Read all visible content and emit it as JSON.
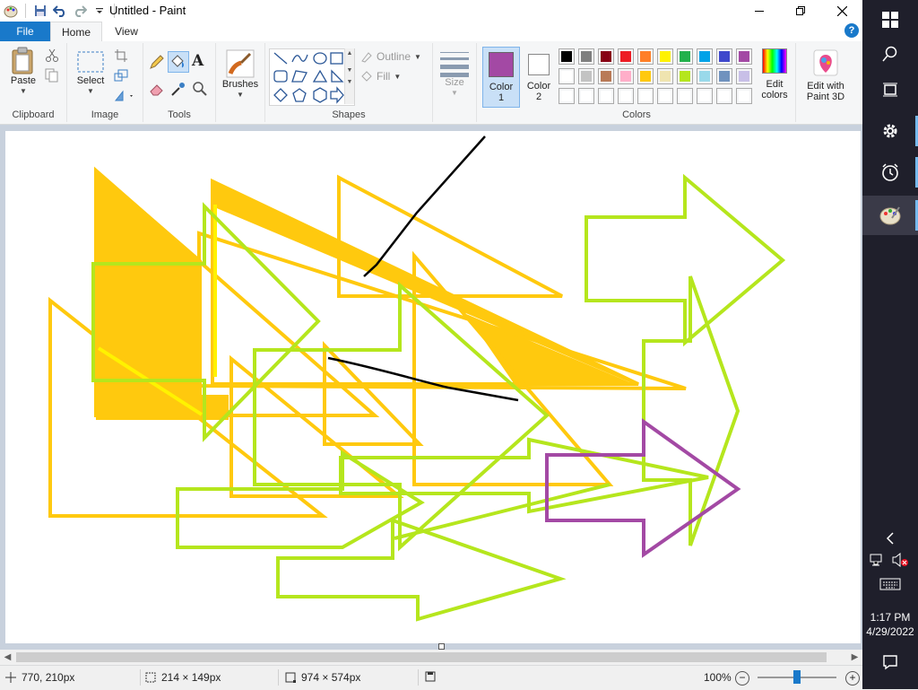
{
  "window": {
    "title": "Untitled - Paint"
  },
  "tabs": {
    "file": "File",
    "home": "Home",
    "view": "View"
  },
  "ribbon": {
    "clipboard": {
      "paste": "Paste",
      "group": "Clipboard"
    },
    "image": {
      "select": "Select",
      "group": "Image"
    },
    "tools": {
      "group": "Tools"
    },
    "brushes": {
      "label": "Brushes"
    },
    "shapes": {
      "group": "Shapes",
      "outline": "Outline",
      "fill": "Fill"
    },
    "size": {
      "label": "Size"
    },
    "colors": {
      "group": "Colors",
      "color1": "Color\n1",
      "color1_line1": "Color",
      "color1_line2": "1",
      "color2_line1": "Color",
      "color2_line2": "2",
      "color1_value": "#a349a4",
      "color2_value": "#ffffff",
      "edit_line1": "Edit",
      "edit_line2": "colors",
      "palette_row1": [
        "#000000",
        "#7f7f7f",
        "#880015",
        "#ed1c24",
        "#ff7f27",
        "#fff200",
        "#22b14c",
        "#00a2e8",
        "#3f48cc",
        "#a349a4"
      ],
      "palette_row2": [
        "#ffffff",
        "#c3c3c3",
        "#b97a57",
        "#ffaec9",
        "#ffc90e",
        "#efe4b0",
        "#b5e61d",
        "#99d9ea",
        "#7092be",
        "#c8bfe7"
      ],
      "palette_row3": [
        "#ffffff",
        "#ffffff",
        "#ffffff",
        "#ffffff",
        "#ffffff",
        "#ffffff",
        "#ffffff",
        "#ffffff",
        "#ffffff",
        "#ffffff"
      ]
    },
    "paint3d": {
      "line1": "Edit with",
      "line2": "Paint 3D"
    }
  },
  "status": {
    "cursor": "770, 210px",
    "selection": "214 × 149px",
    "canvas_size": "974 × 574px",
    "zoom": "100%",
    "zoom_fraction": 0.5
  },
  "taskbar": {
    "time": "1:17 PM",
    "date": "4/29/2022"
  }
}
